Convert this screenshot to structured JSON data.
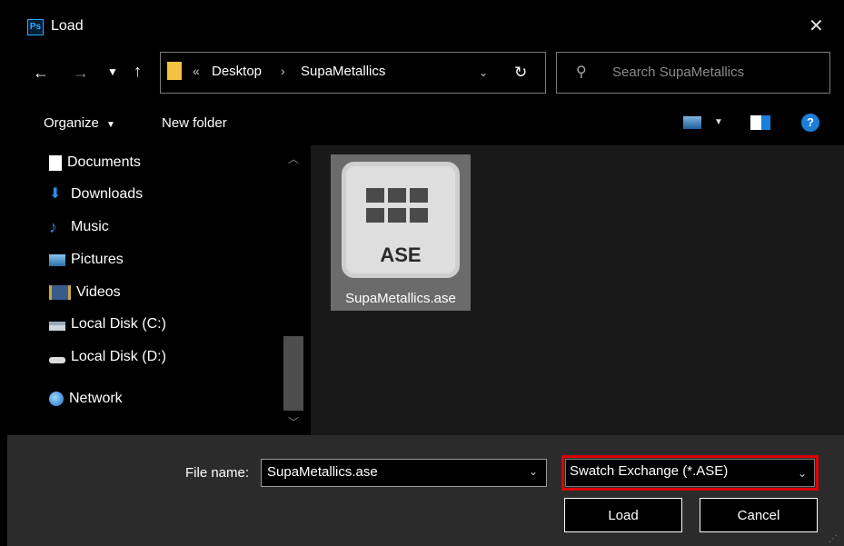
{
  "window": {
    "title": "Load",
    "app_badge": "Ps"
  },
  "nav": {
    "breadcrumb_prefix": "«",
    "breadcrumb": [
      "Desktop",
      "SupaMetallics"
    ],
    "search_placeholder": "Search SupaMetallics"
  },
  "toolbar": {
    "organize": "Organize",
    "new_folder": "New folder"
  },
  "sidebar": {
    "items": [
      {
        "label": "Documents",
        "icon": "document-icon"
      },
      {
        "label": "Downloads",
        "icon": "download-arrow-icon"
      },
      {
        "label": "Music",
        "icon": "music-note-icon"
      },
      {
        "label": "Pictures",
        "icon": "picture-icon"
      },
      {
        "label": "Videos",
        "icon": "video-icon"
      },
      {
        "label": "Local Disk (C:)",
        "icon": "disk-c-icon"
      },
      {
        "label": "Local Disk (D:)",
        "icon": "disk-d-icon"
      },
      {
        "label": "Network",
        "icon": "network-icon"
      }
    ]
  },
  "files": [
    {
      "name": "SupaMetallics.ase",
      "badge": "ASE"
    }
  ],
  "footer": {
    "file_name_label": "File name:",
    "file_name_value": "SupaMetallics.ase",
    "filter_value": "Swatch Exchange (*.ASE)",
    "load_button": "Load",
    "cancel_button": "Cancel"
  },
  "colors": {
    "highlight": "#e00000",
    "folder": "#f4c242",
    "help": "#1a7fd8"
  }
}
